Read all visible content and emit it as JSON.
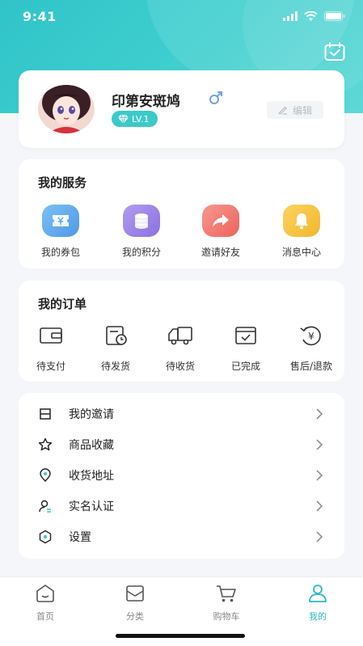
{
  "status_bar": {
    "time": "9:41"
  },
  "profile": {
    "username": "印第安斑鸠",
    "gender": "male",
    "level": "LV.1",
    "edit_label": "编辑"
  },
  "services": {
    "title": "我的服务",
    "items": [
      {
        "label": "我的券包",
        "icon": "coupon-icon",
        "color": "#5aa8ec"
      },
      {
        "label": "我的积分",
        "icon": "points-icon",
        "color": "#9b86e8"
      },
      {
        "label": "邀请好友",
        "icon": "share-icon",
        "color": "#f07a72"
      },
      {
        "label": "消息中心",
        "icon": "bell-icon",
        "color": "#f6c340"
      }
    ]
  },
  "orders": {
    "title": "我的订单",
    "items": [
      {
        "label": "待支付",
        "icon": "wallet-icon"
      },
      {
        "label": "待发货",
        "icon": "clock-box-icon"
      },
      {
        "label": "待收货",
        "icon": "truck-icon"
      },
      {
        "label": "已完成",
        "icon": "check-box-icon"
      },
      {
        "label": "售后/退款",
        "icon": "refund-icon"
      }
    ]
  },
  "menu": {
    "items": [
      {
        "label": "我的邀请",
        "icon": "invite-icon"
      },
      {
        "label": "商品收藏",
        "icon": "star-icon"
      },
      {
        "label": "收货地址",
        "icon": "location-icon"
      },
      {
        "label": "实名认证",
        "icon": "user-verify-icon"
      },
      {
        "label": "设置",
        "icon": "settings-icon"
      }
    ]
  },
  "tabbar": {
    "tabs": [
      {
        "label": "首页",
        "icon": "home-icon",
        "active": false
      },
      {
        "label": "分类",
        "icon": "category-icon",
        "active": false
      },
      {
        "label": "购物车",
        "icon": "cart-icon",
        "active": false
      },
      {
        "label": "我的",
        "icon": "profile-icon",
        "active": true
      }
    ]
  },
  "colors": {
    "accent": "#3cc9c9",
    "active_tab": "#2fb9bf"
  }
}
